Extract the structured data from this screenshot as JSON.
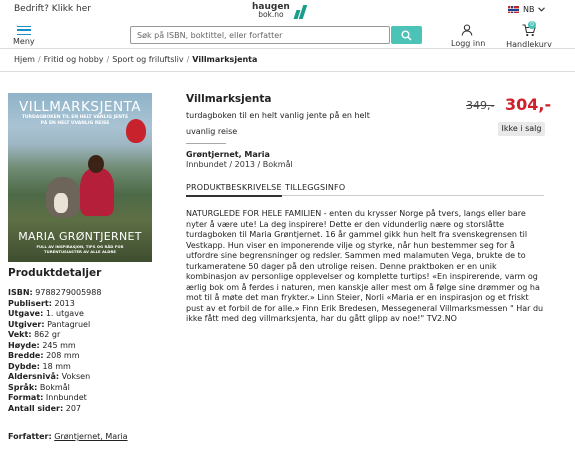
{
  "topbar": {
    "bedrift": "Bedrift? Klikk her",
    "language": "NB"
  },
  "logo": {
    "line1": "haugen",
    "line2": "bok.no"
  },
  "header": {
    "menu_label": "Meny",
    "search_placeholder": "Søk på ISBN, boktittel, eller forfatter",
    "login_label": "Logg inn",
    "cart_label": "Handlekurv",
    "cart_count": "0"
  },
  "breadcrumb": {
    "items": [
      "Hjem",
      "Fritid og hobby",
      "Sport og friluftsliv"
    ],
    "current": "Villmarksjenta"
  },
  "cover": {
    "title": "VILLMARKSJENTA",
    "subtitle": "TURDAGBOKEN TIL EN HELT VANLIG JENTE PÅ EN HELT UVANLIG REISE",
    "author": "MARIA GRØNTJERNET",
    "footer": "FULL AV INSPIRASJON, TIPS OG RÅD FOR TURENTUSIASTER AV ALLE ALDRE"
  },
  "product": {
    "title": "Villmarksjenta",
    "subtitle": "turdagboken til en helt vanlig jente på en helt uvanlig reise",
    "author": "Grøntjernet, Maria",
    "format": "Innbundet / 2013 / Bokmål",
    "old_price": "349,-",
    "price": "304,-",
    "stock": "Ikke i salg"
  },
  "tabs": {
    "description": "PRODUKTBESKRIVELSE",
    "extra": "TILLEGGSINFO"
  },
  "description": "NATURGLEDE FOR HELE FAMILIEN - enten du krysser Norge på tvers, langs eller bare nyter å være ute! La deg inspirere! Dette er den vidunderlig nære og storslåtte turdagboken til Maria Grøntjernet. 16 år gammel gikk hun helt fra svenskegrensen til Vestkapp. Hun viser en imponerende vilje og styrke, når hun bestemmer seg for å utfordre sine begrensninger og redsler. Sammen med malamuten Vega, brukte de to turkameratene 50 dager på den utrolige reisen. Denne praktboken er en unik kombinasjon av personlige opplevelser og komplette turtips! «En inspirerende, varm og ærlig bok om å ferdes i naturen, men kanskje aller mest om å følge sine drømmer og ha mot til å møte det man frykter.» Linn Steier, Norli «Maria er en inspirasjon og et friskt pust av et forbil de for alle.» Finn Erik Bredesen, Messegeneral Villmarksmessen \" Har du ikke fått med deg villmarksjenta, har du gått glipp av noe!\" TV2.NO",
  "details": {
    "heading": "Produktdetaljer",
    "rows": [
      {
        "k": "ISBN:",
        "v": "9788279005988"
      },
      {
        "k": "Publisert:",
        "v": "2013"
      },
      {
        "k": "Utgave:",
        "v": "1. utgave"
      },
      {
        "k": "Utgiver:",
        "v": "Pantagruel"
      },
      {
        "k": "Vekt:",
        "v": "862 gr"
      },
      {
        "k": "Høyde:",
        "v": "245 mm"
      },
      {
        "k": "Bredde:",
        "v": "208 mm"
      },
      {
        "k": "Dybde:",
        "v": "18 mm"
      },
      {
        "k": "Aldersnivå:",
        "v": "Voksen"
      },
      {
        "k": "Språk:",
        "v": "Bokmål"
      },
      {
        "k": "Format:",
        "v": "Innbundet"
      },
      {
        "k": "Antall sider:",
        "v": "207"
      }
    ],
    "forfatter_label": "Forfatter:",
    "forfatter_value": "Grøntjernet, Maria"
  }
}
